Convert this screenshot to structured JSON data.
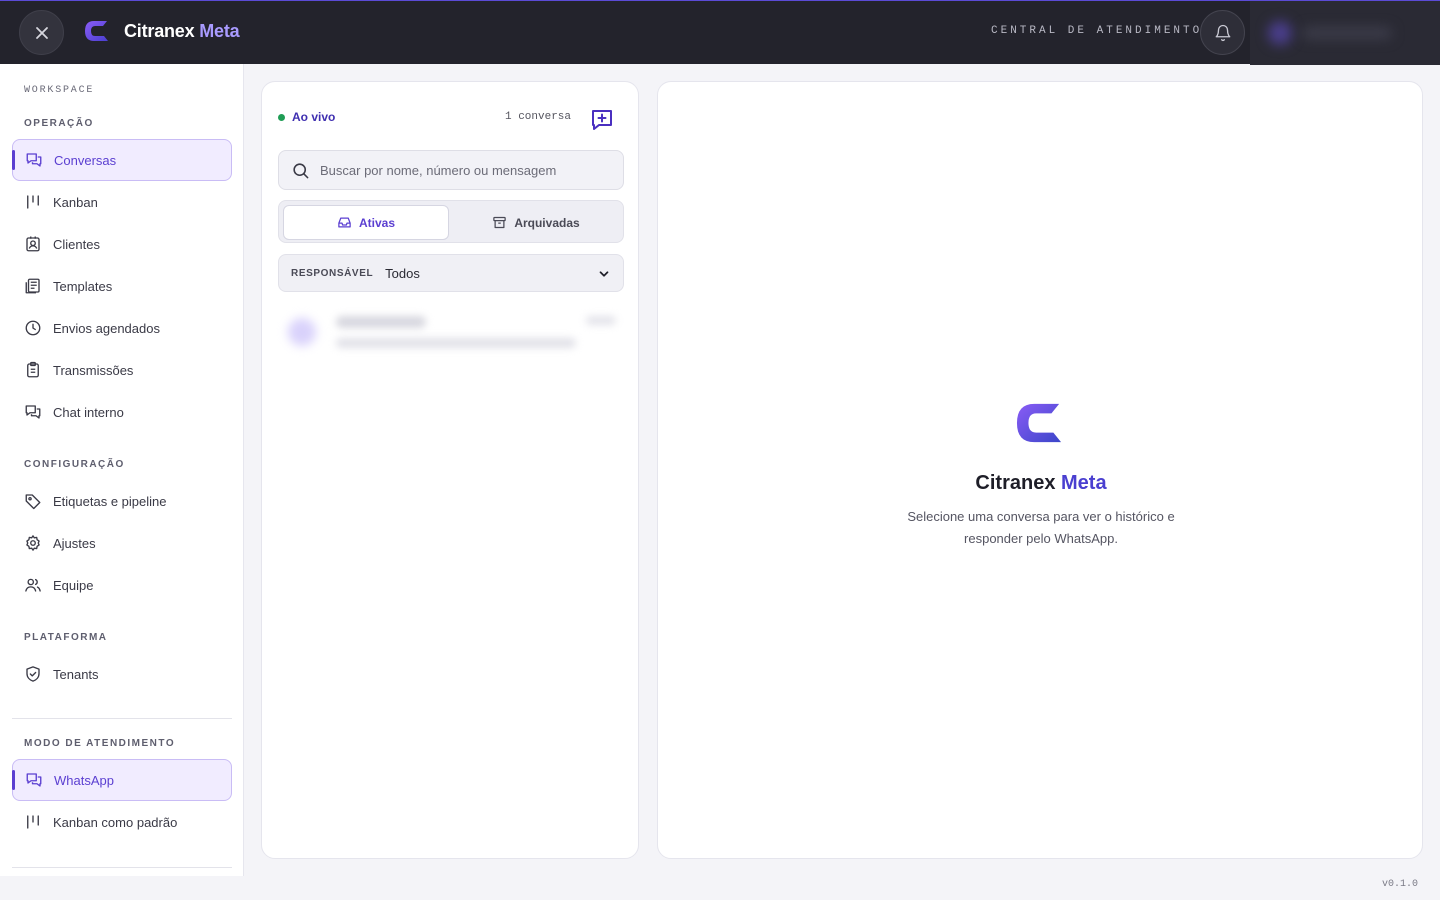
{
  "header": {
    "brand_main": "Citranex",
    "brand_accent": "Meta",
    "central_label": "CENTRAL DE ATENDIMENTO"
  },
  "sidebar": {
    "workspace_label": "WORKSPACE",
    "sections": [
      {
        "label": "OPERAÇÃO",
        "items": [
          {
            "label": "Conversas",
            "icon": "chat-icon",
            "active": true
          },
          {
            "label": "Kanban",
            "icon": "kanban-icon"
          },
          {
            "label": "Clientes",
            "icon": "contact-icon"
          },
          {
            "label": "Templates",
            "icon": "templates-icon"
          },
          {
            "label": "Envios agendados",
            "icon": "clock-icon"
          },
          {
            "label": "Transmissões",
            "icon": "clipboard-icon"
          },
          {
            "label": "Chat interno",
            "icon": "chat-icon"
          }
        ]
      },
      {
        "label": "CONFIGURAÇÃO",
        "items": [
          {
            "label": "Etiquetas e pipeline",
            "icon": "tag-icon"
          },
          {
            "label": "Ajustes",
            "icon": "gear-icon"
          },
          {
            "label": "Equipe",
            "icon": "users-icon"
          }
        ]
      },
      {
        "label": "PLATAFORMA",
        "items": [
          {
            "label": "Tenants",
            "icon": "shield-icon"
          }
        ]
      },
      {
        "label": "MODO DE ATENDIMENTO",
        "items": [
          {
            "label": "WhatsApp",
            "icon": "chat-icon",
            "active": true
          },
          {
            "label": "Kanban como padrão",
            "icon": "kanban-icon"
          }
        ]
      }
    ]
  },
  "conversations": {
    "live_label": "Ao vivo",
    "count_label": "1 conversa",
    "search_placeholder": "Buscar por nome, número ou mensagem",
    "tabs": [
      {
        "label": "Ativas",
        "active": true
      },
      {
        "label": "Arquivadas"
      }
    ],
    "responsavel_label": "RESPONSÁVEL",
    "responsavel_value": "Todos"
  },
  "empty_state": {
    "title_main": "Citranex",
    "title_accent": "Meta",
    "description": "Selecione uma conversa para ver o histórico e responder pelo WhatsApp."
  },
  "version": "v0.1.0",
  "colors": {
    "accent": "#5b3fd1",
    "topbar": "#23232c",
    "live_dot": "#1f9d55"
  }
}
